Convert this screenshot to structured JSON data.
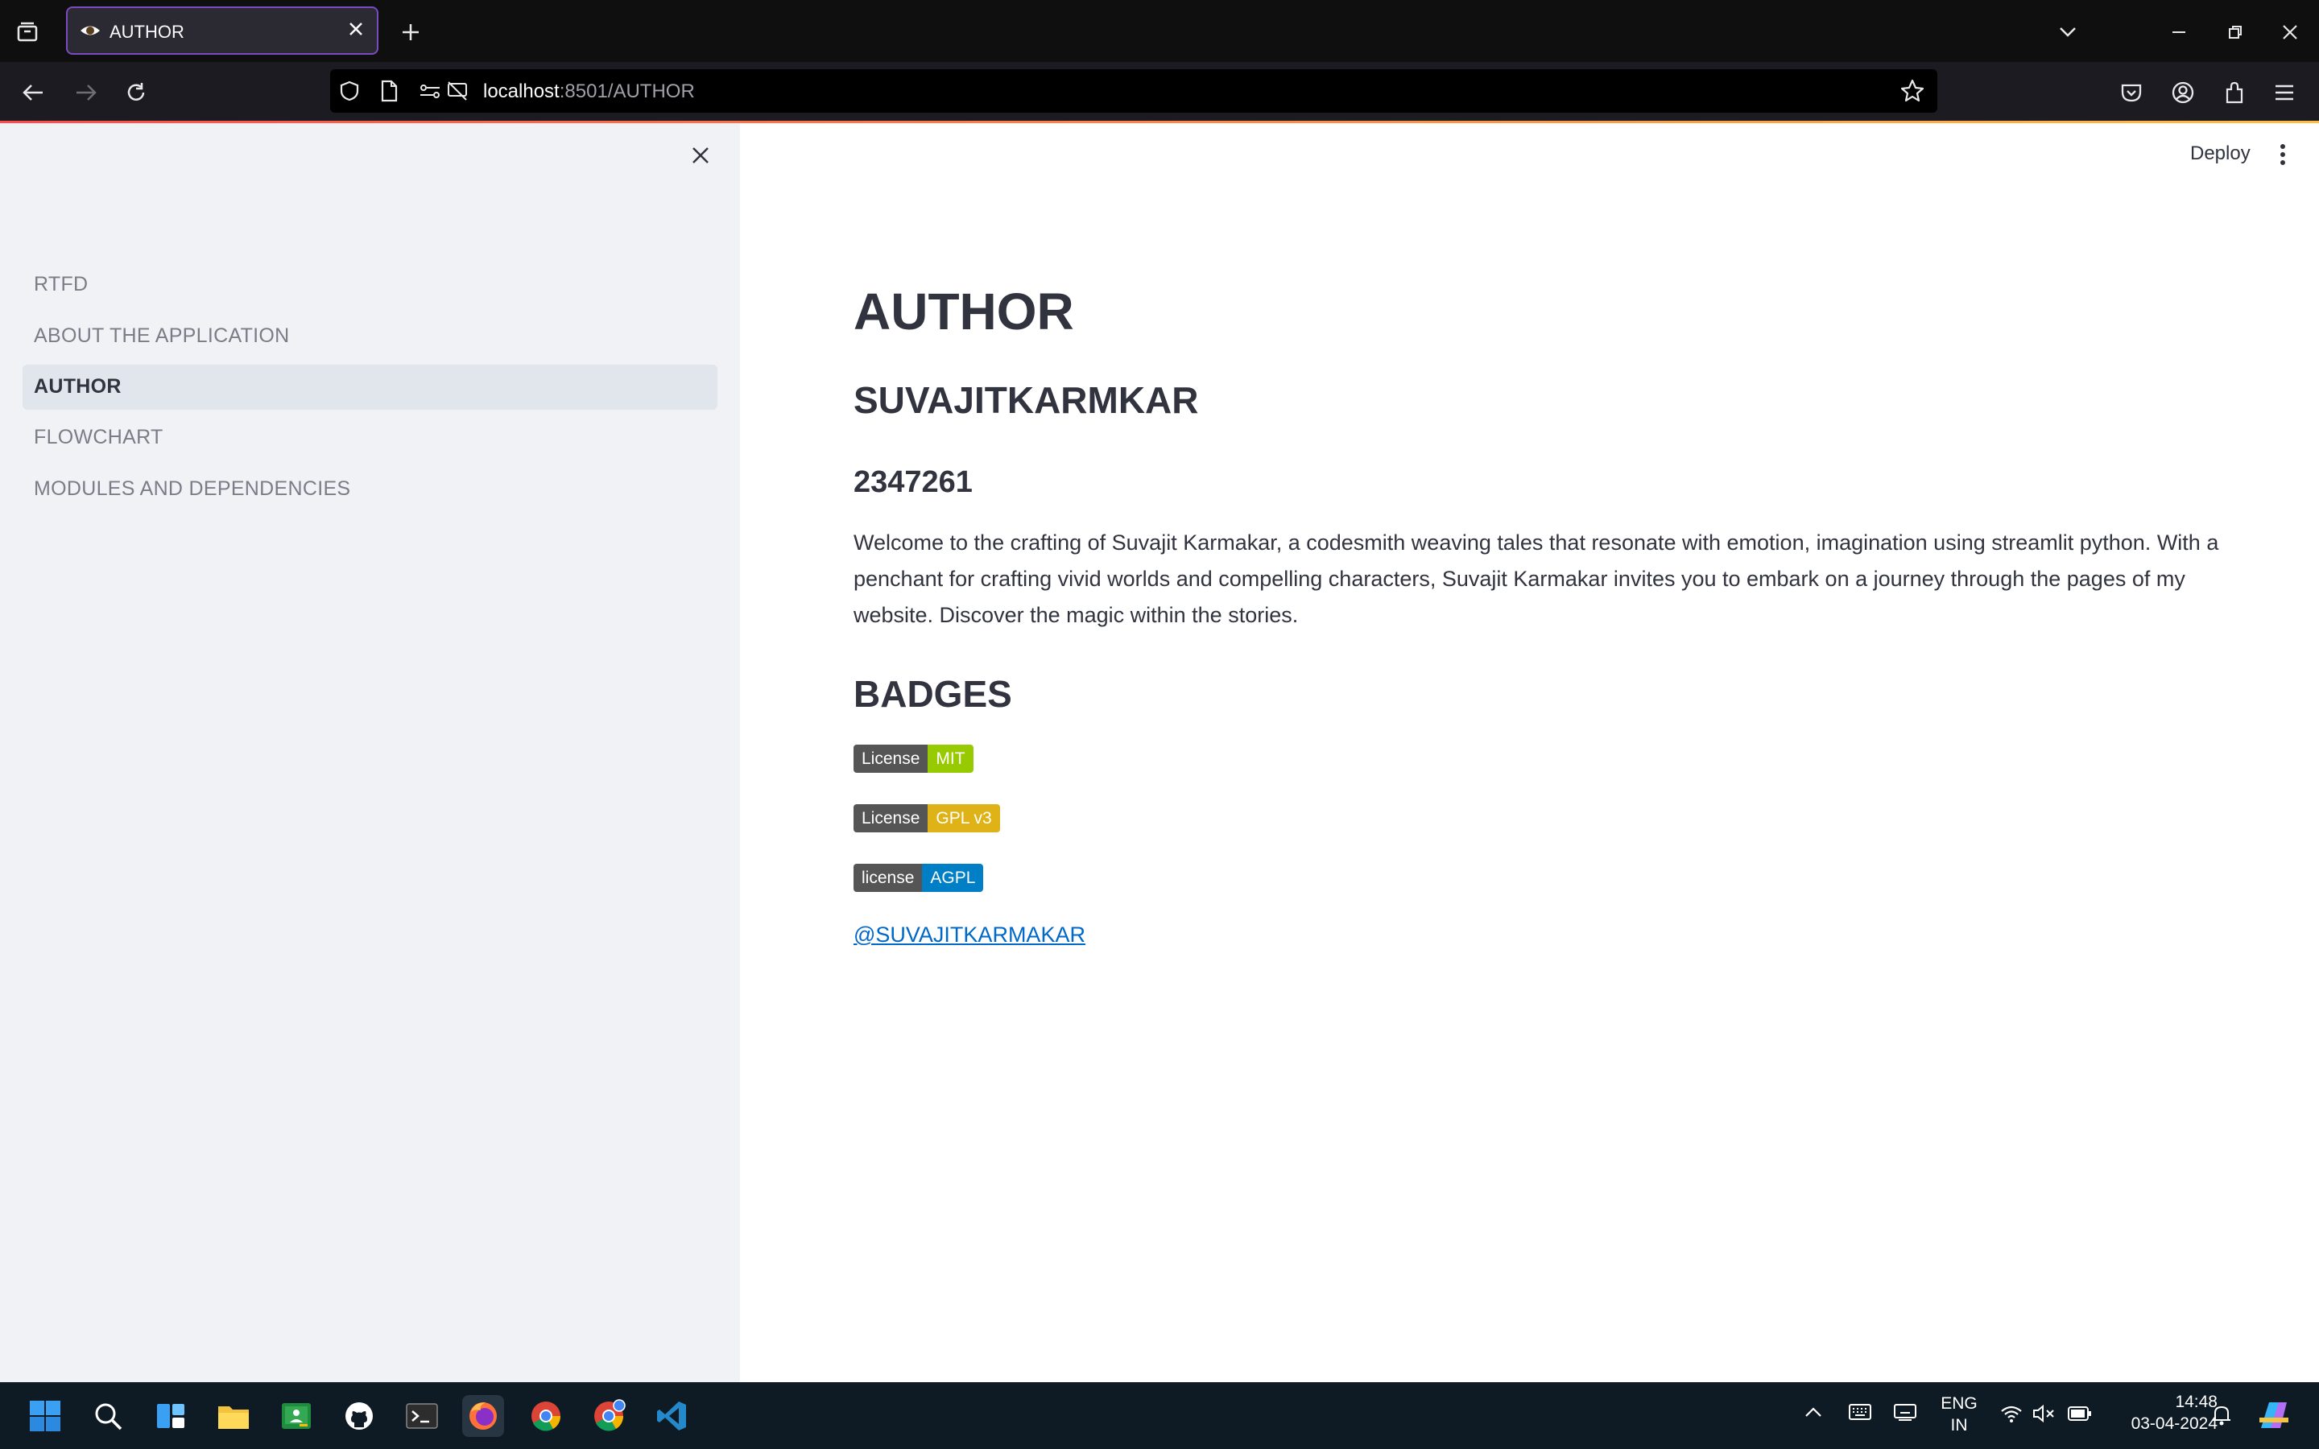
{
  "browser": {
    "tab_title": "AUTHOR",
    "url_host": "localhost",
    "url_path": ":8501/AUTHOR"
  },
  "app": {
    "deploy_label": "Deploy"
  },
  "sidebar": {
    "items": [
      {
        "label": "RTFD"
      },
      {
        "label": "ABOUT THE APPLICATION"
      },
      {
        "label": "AUTHOR"
      },
      {
        "label": "FLOWCHART"
      },
      {
        "label": "MODULES AND DEPENDENCIES"
      }
    ]
  },
  "main": {
    "title": "AUTHOR",
    "name": "SUVAJITKARMKAR",
    "id_number": "2347261",
    "intro": "Welcome to the crafting of Suvajit Karmakar, a codesmith weaving tales that resonate with emotion, imagination using streamlit python. With a penchant for crafting vivid worlds and compelling characters, Suvajit Karmakar invites you to embark on a journey through the pages of my website. Discover the magic within the stories.",
    "badges_heading": "BADGES",
    "badges": [
      {
        "left": "License",
        "right": "MIT",
        "color": "#97ca00"
      },
      {
        "left": "License",
        "right": "GPL v3",
        "color": "#dfb317"
      },
      {
        "left": "license",
        "right": "AGPL",
        "color": "#007ec6"
      }
    ],
    "handle": "@SUVAJITKARMAKAR"
  },
  "taskbar": {
    "lang_top": "ENG",
    "lang_bottom": "IN",
    "time": "14:48",
    "date": "03-04-2024"
  },
  "colors": {
    "accent_red": "#ff4b4b",
    "link": "#0068c9",
    "sidebar_bg": "#f0f2f6",
    "tab_border": "#7b4bc2"
  }
}
